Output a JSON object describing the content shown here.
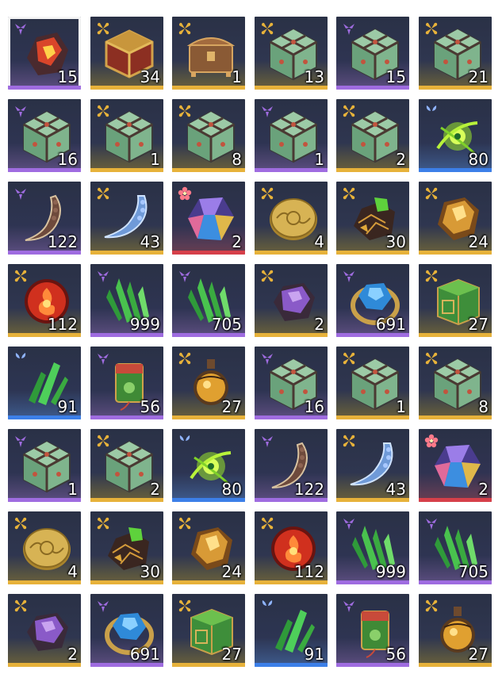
{
  "inventory": {
    "colors": {
      "gold": "#e7b23a",
      "purple": "#9f6ce0",
      "blue": "#3c7fe8",
      "red": "#d6404a"
    },
    "selected_index": 0,
    "items": [
      {
        "icon": "fire-ore-icon",
        "quality": "purple",
        "qty": "15"
      },
      {
        "icon": "red-gold-chest-icon",
        "quality": "gold",
        "qty": "34"
      },
      {
        "icon": "bronze-chest-icon",
        "quality": "gold",
        "qty": "1"
      },
      {
        "icon": "jade-dice-box-icon",
        "quality": "gold",
        "qty": "13"
      },
      {
        "icon": "jade-dice-box-icon",
        "quality": "purple",
        "qty": "15"
      },
      {
        "icon": "jade-dice-box-icon",
        "quality": "gold",
        "qty": "21"
      },
      {
        "icon": "jade-dice-box-icon",
        "quality": "purple",
        "qty": "16"
      },
      {
        "icon": "jade-dice-box-icon",
        "quality": "gold",
        "qty": "1"
      },
      {
        "icon": "jade-dice-box-icon",
        "quality": "gold",
        "qty": "8"
      },
      {
        "icon": "jade-dice-box-icon",
        "quality": "purple",
        "qty": "1"
      },
      {
        "icon": "jade-dice-box-icon",
        "quality": "gold",
        "qty": "2"
      },
      {
        "icon": "green-spirit-wisp-icon",
        "quality": "blue",
        "qty": "80"
      },
      {
        "icon": "bone-claw-icon",
        "quality": "purple",
        "qty": "122"
      },
      {
        "icon": "ice-claw-icon",
        "quality": "gold",
        "qty": "43"
      },
      {
        "icon": "rainbow-crystal-icon",
        "quality": "red",
        "qty": "2"
      },
      {
        "icon": "gold-coin-icon",
        "quality": "gold",
        "qty": "4"
      },
      {
        "icon": "gem-ore-cluster-icon",
        "quality": "gold",
        "qty": "30"
      },
      {
        "icon": "amber-crystal-icon",
        "quality": "gold",
        "qty": "24"
      },
      {
        "icon": "red-flame-orb-icon",
        "quality": "gold",
        "qty": "112"
      },
      {
        "icon": "green-crystal-shards-icon",
        "quality": "purple",
        "qty": "999"
      },
      {
        "icon": "green-crystal-shards-icon",
        "quality": "purple",
        "qty": "705"
      },
      {
        "icon": "purple-ore-icon",
        "quality": "gold",
        "qty": "2"
      },
      {
        "icon": "sapphire-ring-icon",
        "quality": "purple",
        "qty": "691"
      },
      {
        "icon": "jade-seal-cube-icon",
        "quality": "gold",
        "qty": "27"
      },
      {
        "icon": "green-crystal-icon",
        "quality": "blue",
        "qty": "91"
      },
      {
        "icon": "jade-tag-icon",
        "quality": "purple",
        "qty": "56"
      },
      {
        "icon": "amber-potion-icon",
        "quality": "gold",
        "qty": "27"
      },
      {
        "icon": "jade-dice-box-icon",
        "quality": "purple",
        "qty": "16"
      },
      {
        "icon": "jade-dice-box-icon",
        "quality": "gold",
        "qty": "1"
      },
      {
        "icon": "jade-dice-box-icon",
        "quality": "gold",
        "qty": "8"
      },
      {
        "icon": "jade-dice-box-icon",
        "quality": "purple",
        "qty": "1"
      },
      {
        "icon": "jade-dice-box-icon",
        "quality": "gold",
        "qty": "2"
      },
      {
        "icon": "green-spirit-wisp-icon",
        "quality": "blue",
        "qty": "80"
      },
      {
        "icon": "bone-claw-icon",
        "quality": "purple",
        "qty": "122"
      },
      {
        "icon": "ice-claw-icon",
        "quality": "gold",
        "qty": "43"
      },
      {
        "icon": "rainbow-crystal-icon",
        "quality": "red",
        "qty": "2"
      },
      {
        "icon": "gold-coin-icon",
        "quality": "gold",
        "qty": "4"
      },
      {
        "icon": "gem-ore-cluster-icon",
        "quality": "gold",
        "qty": "30"
      },
      {
        "icon": "amber-crystal-icon",
        "quality": "gold",
        "qty": "24"
      },
      {
        "icon": "red-flame-orb-icon",
        "quality": "gold",
        "qty": "112"
      },
      {
        "icon": "green-crystal-shards-icon",
        "quality": "purple",
        "qty": "999"
      },
      {
        "icon": "green-crystal-shards-icon",
        "quality": "purple",
        "qty": "705"
      },
      {
        "icon": "purple-ore-icon",
        "quality": "gold",
        "qty": "2"
      },
      {
        "icon": "sapphire-ring-icon",
        "quality": "purple",
        "qty": "691"
      },
      {
        "icon": "jade-seal-cube-icon",
        "quality": "gold",
        "qty": "27"
      },
      {
        "icon": "green-crystal-icon",
        "quality": "blue",
        "qty": "91"
      },
      {
        "icon": "jade-tag-icon",
        "quality": "purple",
        "qty": "56"
      },
      {
        "icon": "amber-potion-icon",
        "quality": "gold",
        "qty": "27"
      }
    ]
  }
}
